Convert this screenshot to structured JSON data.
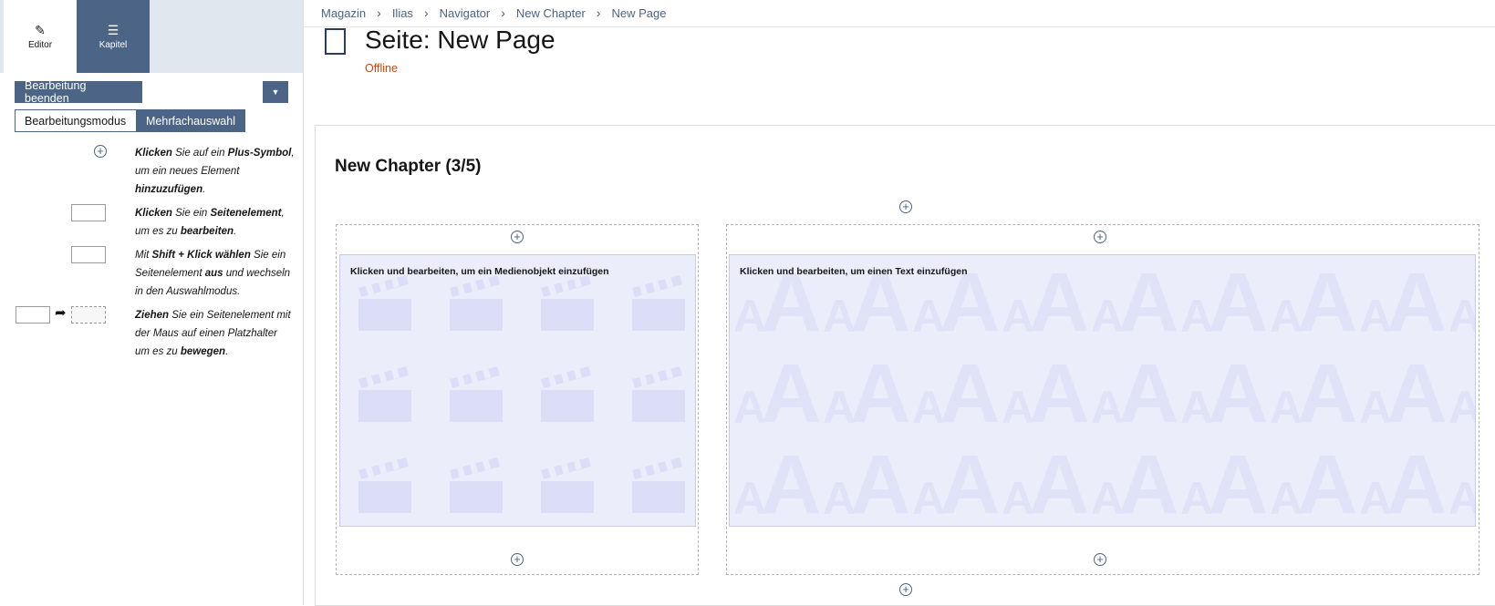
{
  "sidebar": {
    "tabs": [
      {
        "icon": "pencil-icon",
        "label": "Editor"
      },
      {
        "icon": "list-icon",
        "label": "Kapitel"
      }
    ],
    "finish_label": "Bearbeitung beenden",
    "dropdown_icon": "caret-down-icon",
    "modes": [
      "Bearbeitungsmodus",
      "Mehrfachauswahl"
    ],
    "help": [
      {
        "t1": "Klicken",
        "t2": " Sie auf ein ",
        "t3": "Plus-Symbol",
        "t4": ", um ein neues Element ",
        "t5": "hinzuzufügen",
        "t6": "."
      },
      {
        "t1": "Klicken",
        "t2": " Sie ein ",
        "t3": "Seitenelement",
        "t4": ", um es zu ",
        "t5": "bearbeiten",
        "t6": "."
      },
      {
        "t1": "Mit ",
        "t2": "Shift + Klick wählen",
        "t3": " Sie ein Seitenelement ",
        "t4": "aus",
        "t5": " und wechseln in den Auswahlmodus."
      },
      {
        "t1": "Ziehen",
        "t2": " Sie ein Seitenelement mit der Maus auf einen Platzhalter um es zu ",
        "t3": "bewegen",
        "t4": "."
      }
    ]
  },
  "breadcrumbs": [
    "Magazin",
    "Ilias",
    "Navigator",
    "New Chapter",
    "New Page"
  ],
  "page": {
    "title": "Seite: New Page",
    "status": "Offline",
    "chapter": "New Chapter (3/5)"
  },
  "placeholders": {
    "media": "Klicken und bearbeiten, um ein Medienobjekt einzufügen",
    "text": "Klicken und bearbeiten, um einen Text einzufügen"
  },
  "colors": {
    "accent": "#4c6586",
    "offline": "#c4490a",
    "panel": "#ecedfb"
  }
}
